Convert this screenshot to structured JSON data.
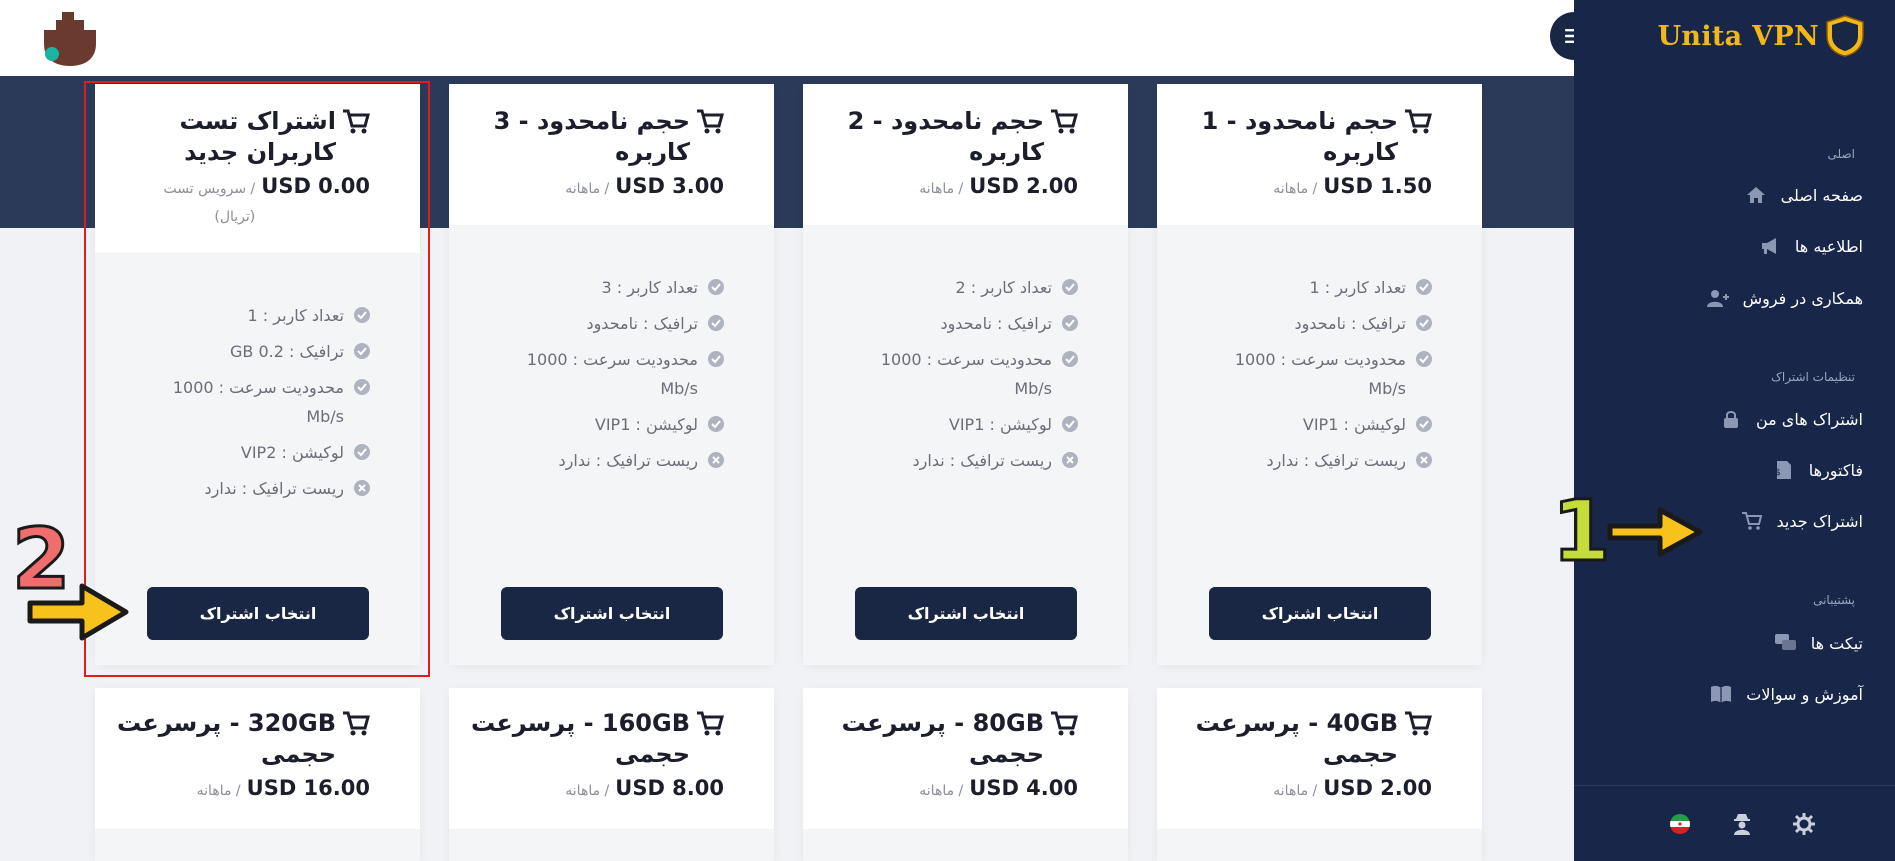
{
  "header": {
    "menu_icon": "hamburger-icon"
  },
  "sidebar": {
    "brand": "Unita VPN",
    "sections": [
      {
        "title": "اصلی",
        "items": [
          {
            "label": "صفحه اصلی",
            "icon": "home-icon"
          },
          {
            "label": "اطلاعیه ها",
            "icon": "megaphone-icon"
          },
          {
            "label": "همکاری در فروش",
            "icon": "user-plus-icon"
          }
        ]
      },
      {
        "title": "تنظیمات اشتراک",
        "items": [
          {
            "label": "اشتراک های من",
            "icon": "lock-icon"
          },
          {
            "label": "فاکتورها",
            "icon": "invoice-icon"
          },
          {
            "label": "اشتراک جدید",
            "icon": "cart-icon"
          }
        ]
      },
      {
        "title": "پشتیبانی",
        "items": [
          {
            "label": "تیکت ها",
            "icon": "chat-icon"
          },
          {
            "label": "آموزش و سوالات",
            "icon": "book-icon"
          }
        ]
      }
    ],
    "bottom_icons": [
      "iran-flag-icon",
      "user-spy-icon",
      "gear-icon"
    ]
  },
  "annotations": {
    "marker_1": "1",
    "marker_2": "2"
  },
  "plans": [
    {
      "title": "حجم نامحدود - 1 کاربره",
      "price": "USD 1.50",
      "period": "/ ماهانه",
      "features": [
        {
          "text": "تعداد کاربر : 1",
          "ok": true
        },
        {
          "text": "ترافیک : نامحدود",
          "ok": true
        },
        {
          "text": "محدودیت سرعت : 1000 Mb/s",
          "ok": true
        },
        {
          "text": "لوکیشن : VIP1",
          "ok": true
        },
        {
          "text": "ریست ترافیک : ندارد",
          "ok": false
        }
      ],
      "button": "انتخاب اشتراک"
    },
    {
      "title": "حجم نامحدود - 2 کاربره",
      "price": "USD 2.00",
      "period": "/ ماهانه",
      "features": [
        {
          "text": "تعداد کاربر : 2",
          "ok": true
        },
        {
          "text": "ترافیک : نامحدود",
          "ok": true
        },
        {
          "text": "محدودیت سرعت : 1000 Mb/s",
          "ok": true
        },
        {
          "text": "لوکیشن : VIP1",
          "ok": true
        },
        {
          "text": "ریست ترافیک : ندارد",
          "ok": false
        }
      ],
      "button": "انتخاب اشتراک"
    },
    {
      "title": "حجم نامحدود - 3 کاربره",
      "price": "USD 3.00",
      "period": "/ ماهانه",
      "features": [
        {
          "text": "تعداد کاربر : 3",
          "ok": true
        },
        {
          "text": "ترافیک : نامحدود",
          "ok": true
        },
        {
          "text": "محدودیت سرعت : 1000 Mb/s",
          "ok": true
        },
        {
          "text": "لوکیشن : VIP1",
          "ok": true
        },
        {
          "text": "ریست ترافیک : ندارد",
          "ok": false
        }
      ],
      "button": "انتخاب اشتراک"
    },
    {
      "title": "اشتراک تست کاربران جدید",
      "price": "USD 0.00",
      "period": "/ سرویس تست (تریال)",
      "features": [
        {
          "text": "تعداد کاربر : 1",
          "ok": true
        },
        {
          "text": "ترافیک : GB 0.2",
          "ok": true
        },
        {
          "text": "محدودیت سرعت : 1000 Mb/s",
          "ok": true
        },
        {
          "text": "لوکیشن : VIP2",
          "ok": true
        },
        {
          "text": "ریست ترافیک : ندارد",
          "ok": false
        }
      ],
      "button": "انتخاب اشتراک"
    },
    {
      "title": "40GB - پرسرعت حجمی",
      "price": "USD 2.00",
      "period": "/ ماهانه"
    },
    {
      "title": "80GB - پرسرعت حجمی",
      "price": "USD 4.00",
      "period": "/ ماهانه"
    },
    {
      "title": "160GB - پرسرعت حجمی",
      "price": "USD 8.00",
      "period": "/ ماهانه"
    },
    {
      "title": "320GB - پرسرعت حجمی",
      "price": "USD 16.00",
      "period": "/ ماهانه"
    }
  ],
  "colors": {
    "sidebar": "#18264a",
    "band": "#2c3a5a",
    "button": "#1a2744",
    "brand": "#f3b818",
    "highlight": "#e01d1d",
    "arrow": "#f8c21c",
    "marker_1": "#c6dc3a",
    "marker_2": "#f06d6d"
  }
}
